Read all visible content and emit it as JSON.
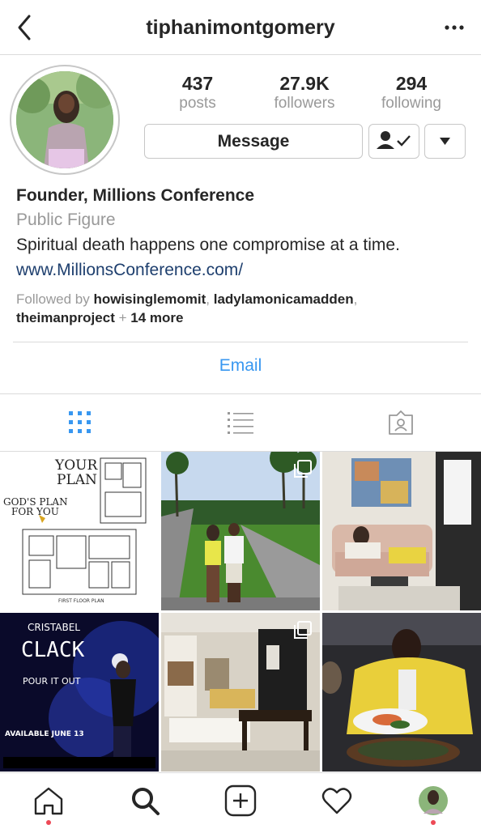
{
  "header": {
    "title": "tiphanimontgomery",
    "back_icon": "chevron-left-icon",
    "more_icon": "ellipsis-icon"
  },
  "profile": {
    "stats": [
      {
        "value": "437",
        "label": "posts"
      },
      {
        "value": "27.9K",
        "label": "followers"
      },
      {
        "value": "294",
        "label": "following"
      }
    ],
    "message_label": "Message",
    "name": "Founder, Millions Conference",
    "category": "Public Figure",
    "bio": "Spiritual death happens one compromise at a time.",
    "website": "www.MillionsConference.com/",
    "followed_by": {
      "prefix": "Followed by ",
      "users": [
        "howisinglemomit",
        "ladylamonicamadden",
        "theimanproject"
      ],
      "suffix_plus": " + ",
      "more": "14 more"
    },
    "email_label": "Email"
  },
  "tabs": [
    "grid-view-icon",
    "list-view-icon",
    "tagged-icon"
  ],
  "grid": {
    "posts": [
      {
        "name": "floor-plan-post",
        "text": [
          "YOUR",
          "PLAN",
          "GOD'S PLAN",
          "FOR YOU",
          "FIRST FLOOR PLAN"
        ]
      },
      {
        "name": "couple-garden-post",
        "multiple": true
      },
      {
        "name": "living-room-post"
      },
      {
        "name": "cristabel-clack-post",
        "text": [
          "CRISTABEL",
          "CLACK",
          "POUR IT OUT",
          "AVAILABLE JUNE 13"
        ]
      },
      {
        "name": "interior-post",
        "multiple": true
      },
      {
        "name": "dinner-post"
      }
    ]
  },
  "colors": {
    "accent": "#3897f0",
    "link": "#1e3f6e",
    "muted": "#999999",
    "notification": "#ed4956"
  },
  "bottom_nav": [
    "home-icon",
    "search-icon",
    "add-post-icon",
    "activity-heart-icon",
    "profile-avatar-icon"
  ]
}
